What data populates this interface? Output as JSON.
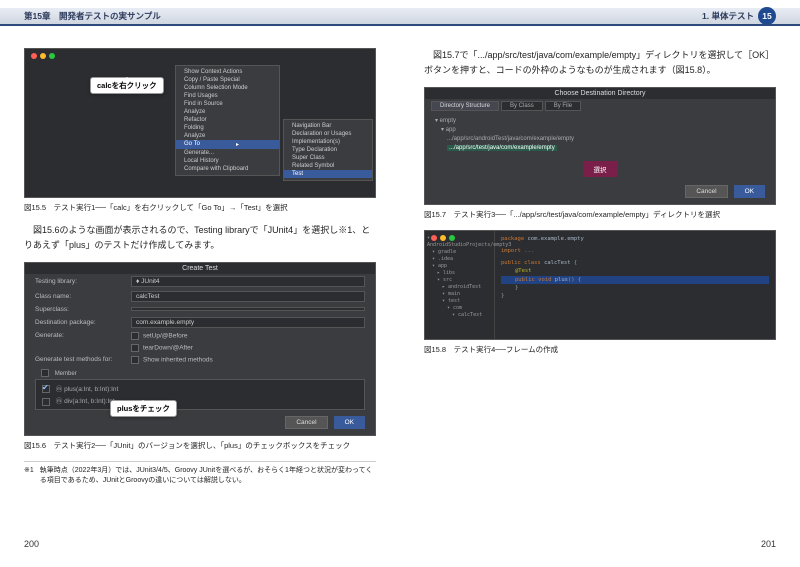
{
  "header": {
    "left": "第15章　開発者テストの実サンプル",
    "right_section": "1. 単体テスト",
    "chapter_num": "15"
  },
  "left_page": {
    "fig5": {
      "callout": "calcを右クリック",
      "caption": "図15.5　テスト実行1──「calc」を右クリックして「Go To」→「Test」を選択",
      "menu_a": [
        "Show Context Actions",
        "Copy / Paste Special",
        "Column Selection Mode",
        "Find Usages",
        "Find in Source",
        "Analyze",
        "Refactor",
        "Folding",
        "Analyze",
        "Go To",
        "Generate...",
        "Local History",
        "Compare with Clipboard"
      ],
      "menu_a_sel": "Go To",
      "menu_b": [
        "Navigation Bar",
        "Declaration or Usages",
        "Implementation(s)",
        "Type Declaration",
        "Super Class",
        "Related Symbol",
        "Test"
      ],
      "menu_b_sel": "Test"
    },
    "para1": "図15.6のような画面が表示されるので、Testing libraryで「JUnit4」を選択し※1、とりあえず「plus」のテストだけ作成してみます。",
    "fig6": {
      "title": "Create Test",
      "labels": {
        "testing_library": "Testing library:",
        "class_name": "Class name:",
        "superclass": "Superclass:",
        "destination": "Destination package:",
        "generate": "Generate:",
        "gen_methods_for": "Generate test methods for:",
        "member": "Member"
      },
      "values": {
        "testing_library": "♦ JUnit4",
        "class_name": "calcTest",
        "destination": "com.example.empty",
        "setup": "setUp/@Before",
        "teardown": "tearDown/@After",
        "show_inherited": "Show inherited methods"
      },
      "methods": [
        {
          "sig": "plus(a:Int, b:Int):Int",
          "checked": true
        },
        {
          "sig": "div(a:Int, b:Int):Int",
          "checked": false
        }
      ],
      "callout": "plusをチェック",
      "buttons": {
        "cancel": "Cancel",
        "ok": "OK"
      },
      "caption": "図15.6　テスト実行2──「JUnit」のバージョンを選択し、「plus」のチェックボックスをチェック"
    },
    "footnote": {
      "mark": "※1",
      "text": "執筆時点（2022年3月）では、JUnit3/4/5、Groovy JUnitを選べるが、おそらく1年経つと状況が変わってくる項目であるため、JUnitとGroovyの違いについては解説しない。"
    },
    "page_num": "200"
  },
  "right_page": {
    "para1": "図15.7で「.../app/src/test/java/com/example/empty」ディレクトリを選択して［OK］ボタンを押すと、コードの外枠のようなものが生成されます（図15.8）。",
    "fig7": {
      "title": "Choose Destination Directory",
      "tabs": [
        "Directory Structure",
        "By Class",
        "By File"
      ],
      "tree": [
        "▾ empty",
        "　▾ app",
        "　　.../app/src/androidTest/java/com/example/empty",
        "　　.../app/src/test/java/com/example/empty"
      ],
      "tree_sel_index": 3,
      "select_label": "選択",
      "buttons": {
        "cancel": "Cancel",
        "ok": "OK"
      },
      "caption": "図15.7　テスト実行3──「.../app/src/test/java/com/example/empty」ディレクトリを選択"
    },
    "fig8": {
      "sidebar": [
        "▾ AndroidStudioProjects/empty3",
        "　▾ gradle",
        "　▾ .idea",
        "　▾ app",
        "　　▸ libs",
        "　　▾ src",
        "　　　▸ androidTest",
        "　　　▾ main",
        "　　　▾ test",
        "　　　　▾ com",
        "　　　　　▾ calcTest"
      ],
      "code": {
        "l1": "package com.example.empty",
        "l2": "import ...",
        "l3": "public class calcTest {",
        "anno": "@Test",
        "l4": "public void plus() {",
        "l5": "}",
        "l6": "}"
      },
      "caption": "図15.8　テスト実行4──フレームの作成"
    },
    "page_num": "201"
  }
}
